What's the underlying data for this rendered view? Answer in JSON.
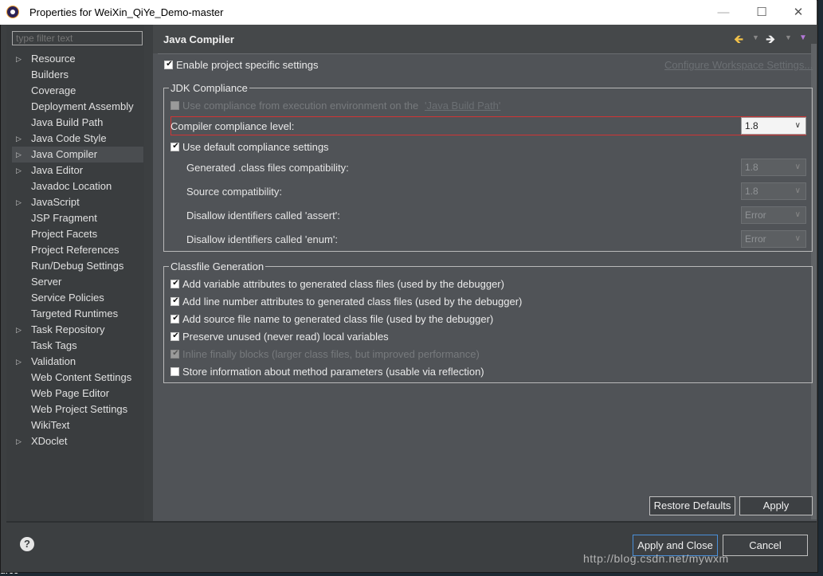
{
  "window": {
    "title": "Properties for WeiXin_QiYe_Demo-master"
  },
  "filter": {
    "placeholder": "type filter text"
  },
  "tree": [
    {
      "label": "Resource",
      "expandable": true
    },
    {
      "label": "Builders",
      "expandable": false
    },
    {
      "label": "Coverage",
      "expandable": false
    },
    {
      "label": "Deployment Assembly",
      "expandable": false
    },
    {
      "label": "Java Build Path",
      "expandable": false
    },
    {
      "label": "Java Code Style",
      "expandable": true
    },
    {
      "label": "Java Compiler",
      "expandable": true,
      "selected": true
    },
    {
      "label": "Java Editor",
      "expandable": true
    },
    {
      "label": "Javadoc Location",
      "expandable": false
    },
    {
      "label": "JavaScript",
      "expandable": true
    },
    {
      "label": "JSP Fragment",
      "expandable": false
    },
    {
      "label": "Project Facets",
      "expandable": false
    },
    {
      "label": "Project References",
      "expandable": false
    },
    {
      "label": "Run/Debug Settings",
      "expandable": false
    },
    {
      "label": "Server",
      "expandable": false
    },
    {
      "label": "Service Policies",
      "expandable": false
    },
    {
      "label": "Targeted Runtimes",
      "expandable": false
    },
    {
      "label": "Task Repository",
      "expandable": true
    },
    {
      "label": "Task Tags",
      "expandable": false
    },
    {
      "label": "Validation",
      "expandable": true
    },
    {
      "label": "Web Content Settings",
      "expandable": false
    },
    {
      "label": "Web Page Editor",
      "expandable": false
    },
    {
      "label": "Web Project Settings",
      "expandable": false
    },
    {
      "label": "WikiText",
      "expandable": false
    },
    {
      "label": "XDoclet",
      "expandable": true
    }
  ],
  "page": {
    "title": "Java Compiler",
    "enable_specific": {
      "label": "Enable project specific settings",
      "checked": true
    },
    "configure_link": "Configure Workspace Settings...",
    "jdk": {
      "title": "JDK Compliance",
      "use_env": {
        "label": "Use compliance from execution environment on the ",
        "link": "'Java Build Path'",
        "checked": false
      },
      "compliance_label": "Compiler compliance level:",
      "compliance_value": "1.8",
      "use_default": {
        "label": "Use default compliance settings",
        "checked": true
      },
      "rows": [
        {
          "label": "Generated .class files compatibility:",
          "value": "1.8"
        },
        {
          "label": "Source compatibility:",
          "value": "1.8"
        },
        {
          "label": "Disallow identifiers called 'assert':",
          "value": "Error"
        },
        {
          "label": "Disallow identifiers called 'enum':",
          "value": "Error"
        }
      ]
    },
    "classfile": {
      "title": "Classfile Generation",
      "options": [
        {
          "label": "Add variable attributes to generated class files (used by the debugger)",
          "checked": true,
          "disabled": false
        },
        {
          "label": "Add line number attributes to generated class files (used by the debugger)",
          "checked": true,
          "disabled": false
        },
        {
          "label": "Add source file name to generated class file (used by the debugger)",
          "checked": true,
          "disabled": false
        },
        {
          "label": "Preserve unused (never read) local variables",
          "checked": true,
          "disabled": false
        },
        {
          "label": "Inline finally blocks (larger class files, but improved performance)",
          "checked": true,
          "disabled": true
        },
        {
          "label": "Store information about method parameters (usable via reflection)",
          "checked": false,
          "disabled": false
        }
      ]
    },
    "restore_defaults": "Restore Defaults",
    "apply": "Apply"
  },
  "footer": {
    "apply_close": "Apply and Close",
    "cancel": "Cancel",
    "help_glyph": "?"
  },
  "watermark": "http://blog.csdn.net/mywxm",
  "background_text": "urce"
}
